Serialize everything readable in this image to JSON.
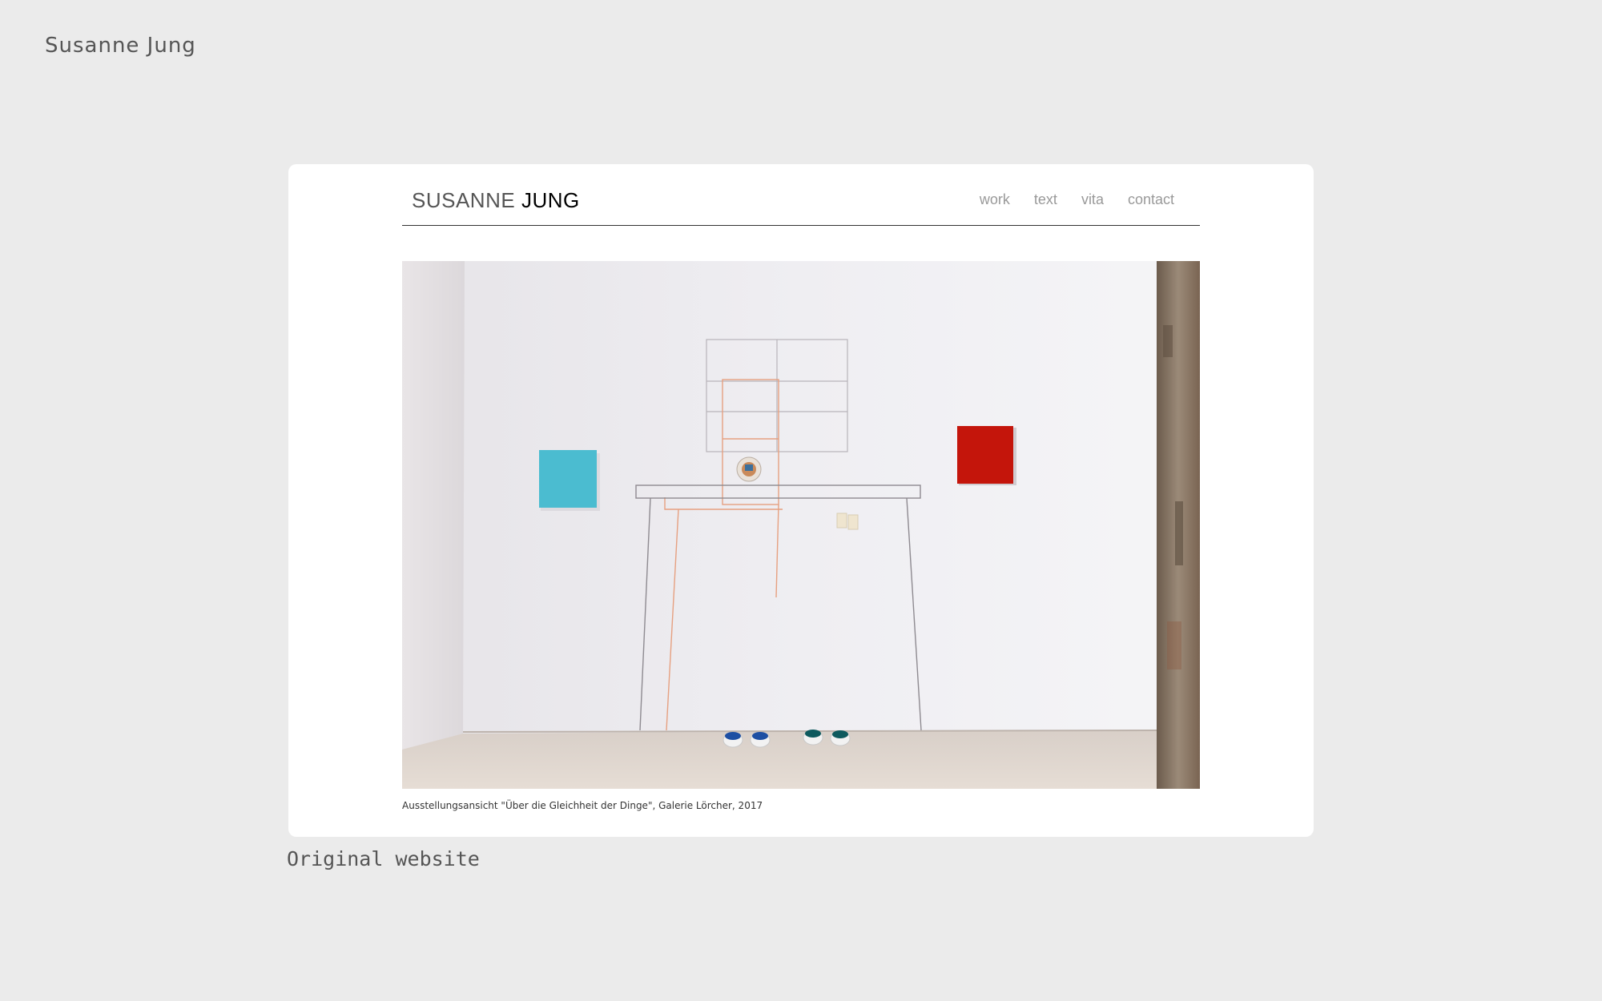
{
  "page": {
    "title": "Susanne Jung",
    "footer_label": "Original website"
  },
  "site": {
    "logo_first": "SUSANNE",
    "logo_last": "JUNG",
    "nav": [
      "work",
      "text",
      "vita",
      "contact"
    ],
    "caption": "Ausstellungsansicht \"Über die Gleichheit der Dinge\", Galerie Lörcher, 2017"
  },
  "colors": {
    "background": "#ebebeb",
    "card": "#ffffff",
    "nav_text": "#999999",
    "artwork_blue": "#4bbcd0",
    "artwork_red": "#c4150b"
  }
}
